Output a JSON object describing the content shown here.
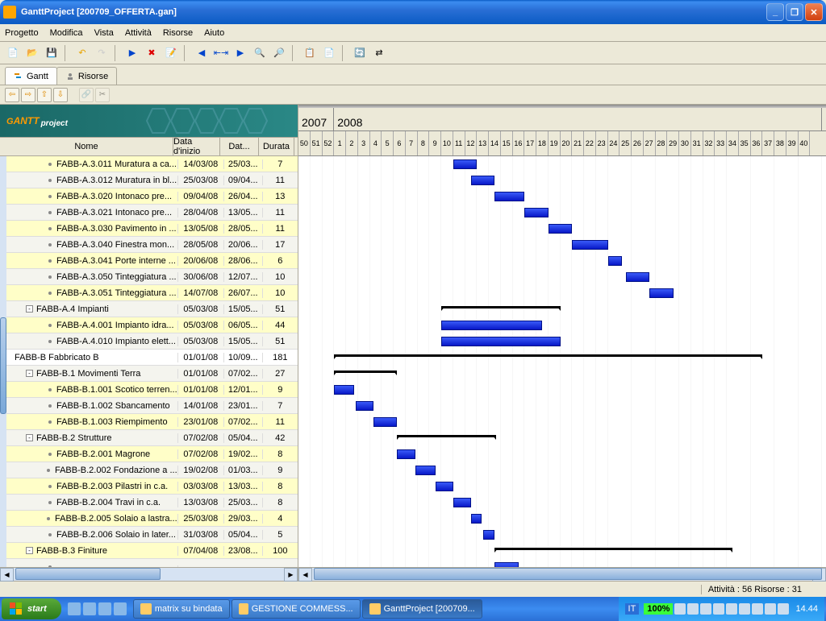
{
  "window": {
    "title": "GanttProject [200709_OFFERTA.gan]"
  },
  "menu": [
    "Progetto",
    "Modifica",
    "Vista",
    "Attività",
    "Risorse",
    "Aiuto"
  ],
  "tabs": {
    "gantt": "Gantt",
    "risorse": "Risorse"
  },
  "columns": {
    "name": "Nome",
    "start": "Data d'inizio",
    "end": "Dat...",
    "dur": "Durata"
  },
  "timeline": {
    "years": [
      {
        "label": "2007",
        "weeks": 3
      },
      {
        "label": "2008",
        "weeks": 41
      }
    ],
    "weeks": [
      50,
      51,
      52,
      1,
      2,
      3,
      4,
      5,
      6,
      7,
      8,
      9,
      10,
      11,
      12,
      13,
      14,
      15,
      16,
      17,
      18,
      19,
      20,
      21,
      22,
      23,
      24,
      25,
      26,
      27,
      28,
      29,
      30,
      31,
      32,
      33,
      34,
      35,
      36,
      37,
      38,
      39,
      40
    ]
  },
  "tasks": [
    {
      "name": "FABB-A.3.011 Muratura a ca...",
      "start": "14/03/08",
      "end": "25/03...",
      "dur": "7",
      "indent": 3,
      "type": "task",
      "barStart": 13,
      "barLen": 2,
      "alt": false,
      "sel": true
    },
    {
      "name": "FABB-A.3.012 Muratura in bl...",
      "start": "25/03/08",
      "end": "09/04...",
      "dur": "11",
      "indent": 3,
      "type": "task",
      "barStart": 14.5,
      "barLen": 2,
      "alt": true
    },
    {
      "name": "FABB-A.3.020 Intonaco pre...",
      "start": "09/04/08",
      "end": "26/04...",
      "dur": "13",
      "indent": 3,
      "type": "task",
      "barStart": 16.5,
      "barLen": 2.5,
      "alt": false,
      "sel": true
    },
    {
      "name": "FABB-A.3.021 Intonaco pre...",
      "start": "28/04/08",
      "end": "13/05...",
      "dur": "11",
      "indent": 3,
      "type": "task",
      "barStart": 19,
      "barLen": 2,
      "alt": true
    },
    {
      "name": "FABB-A.3.030 Pavimento in ...",
      "start": "13/05/08",
      "end": "28/05...",
      "dur": "11",
      "indent": 3,
      "type": "task",
      "barStart": 21,
      "barLen": 2,
      "alt": false,
      "sel": true
    },
    {
      "name": "FABB-A.3.040 Finestra mon...",
      "start": "28/05/08",
      "end": "20/06...",
      "dur": "17",
      "indent": 3,
      "type": "task",
      "barStart": 23,
      "barLen": 3,
      "alt": true
    },
    {
      "name": "FABB-A.3.041 Porte interne ...",
      "start": "20/06/08",
      "end": "28/06...",
      "dur": "6",
      "indent": 3,
      "type": "task",
      "barStart": 26,
      "barLen": 1.2,
      "alt": false,
      "sel": true
    },
    {
      "name": "FABB-A.3.050 Tinteggiatura ...",
      "start": "30/06/08",
      "end": "12/07...",
      "dur": "10",
      "indent": 3,
      "type": "task",
      "barStart": 27.5,
      "barLen": 2,
      "alt": true
    },
    {
      "name": "FABB-A.3.051 Tinteggiatura ...",
      "start": "14/07/08",
      "end": "26/07...",
      "dur": "10",
      "indent": 3,
      "type": "task",
      "barStart": 29.5,
      "barLen": 2,
      "alt": false,
      "sel": true
    },
    {
      "name": "FABB-A.4 Impianti",
      "start": "05/03/08",
      "end": "15/05...",
      "dur": "51",
      "indent": 1,
      "type": "summary",
      "barStart": 12,
      "barLen": 10,
      "alt": true,
      "exp": "-"
    },
    {
      "name": "FABB-A.4.001 Impianto idra...",
      "start": "05/03/08",
      "end": "06/05...",
      "dur": "44",
      "indent": 3,
      "type": "task",
      "barStart": 12,
      "barLen": 8.5,
      "alt": false,
      "sel": true
    },
    {
      "name": "FABB-A.4.010 Impianto elett...",
      "start": "05/03/08",
      "end": "15/05...",
      "dur": "51",
      "indent": 3,
      "type": "task",
      "barStart": 12,
      "barLen": 10,
      "alt": true
    },
    {
      "name": "FABB-B Fabbricato B",
      "start": "01/01/08",
      "end": "10/09...",
      "dur": "181",
      "indent": 0,
      "type": "summary",
      "barStart": 3,
      "barLen": 36,
      "alt": false
    },
    {
      "name": "FABB-B.1 Movimenti Terra",
      "start": "01/01/08",
      "end": "07/02...",
      "dur": "27",
      "indent": 1,
      "type": "summary",
      "barStart": 3,
      "barLen": 5.3,
      "alt": true,
      "exp": "-"
    },
    {
      "name": "FABB-B.1.001 Scotico terren...",
      "start": "01/01/08",
      "end": "12/01...",
      "dur": "9",
      "indent": 3,
      "type": "task",
      "barStart": 3,
      "barLen": 1.7,
      "alt": false,
      "sel": true
    },
    {
      "name": "FABB-B.1.002 Sbancamento",
      "start": "14/01/08",
      "end": "23/01...",
      "dur": "7",
      "indent": 3,
      "type": "task",
      "barStart": 4.8,
      "barLen": 1.5,
      "alt": true
    },
    {
      "name": "FABB-B.1.003 Riempimento",
      "start": "23/01/08",
      "end": "07/02...",
      "dur": "11",
      "indent": 3,
      "type": "task",
      "barStart": 6.3,
      "barLen": 2,
      "alt": false,
      "sel": true
    },
    {
      "name": "FABB-B.2 Strutture",
      "start": "07/02/08",
      "end": "05/04...",
      "dur": "42",
      "indent": 1,
      "type": "summary",
      "barStart": 8.3,
      "barLen": 8.3,
      "alt": true,
      "exp": "-"
    },
    {
      "name": "FABB-B.2.001 Magrone",
      "start": "07/02/08",
      "end": "19/02...",
      "dur": "8",
      "indent": 3,
      "type": "task",
      "barStart": 8.3,
      "barLen": 1.5,
      "alt": false,
      "sel": true
    },
    {
      "name": "FABB-B.2.002 Fondazione a ...",
      "start": "19/02/08",
      "end": "01/03...",
      "dur": "9",
      "indent": 3,
      "type": "task",
      "barStart": 9.8,
      "barLen": 1.7,
      "alt": true
    },
    {
      "name": "FABB-B.2.003 Pilastri in c.a.",
      "start": "03/03/08",
      "end": "13/03...",
      "dur": "8",
      "indent": 3,
      "type": "task",
      "barStart": 11.5,
      "barLen": 1.5,
      "alt": false,
      "sel": true
    },
    {
      "name": "FABB-B.2.004 Travi in c.a.",
      "start": "13/03/08",
      "end": "25/03...",
      "dur": "8",
      "indent": 3,
      "type": "task",
      "barStart": 13,
      "barLen": 1.5,
      "alt": true
    },
    {
      "name": "FABB-B.2.005 Solaio a lastra...",
      "start": "25/03/08",
      "end": "29/03...",
      "dur": "4",
      "indent": 3,
      "type": "task",
      "barStart": 14.5,
      "barLen": 0.9,
      "alt": false,
      "sel": true
    },
    {
      "name": "FABB-B.2.006 Solaio in later...",
      "start": "31/03/08",
      "end": "05/04...",
      "dur": "5",
      "indent": 3,
      "type": "task",
      "barStart": 15.5,
      "barLen": 1,
      "alt": true
    },
    {
      "name": "FABB-B.3 Finiture",
      "start": "07/04/08",
      "end": "23/08...",
      "dur": "100",
      "indent": 1,
      "type": "summary",
      "barStart": 16.5,
      "barLen": 20,
      "alt": false,
      "sel": true,
      "exp": "-"
    },
    {
      "name": "",
      "start": "",
      "end": "",
      "dur": "",
      "indent": 3,
      "type": "task",
      "barStart": 16.5,
      "barLen": 2,
      "alt": true,
      "partial": true
    }
  ],
  "status": "Attività : 56  Risorse : 31",
  "taskbar": {
    "start": "start",
    "items": [
      {
        "label": "matrix su bindata",
        "active": false
      },
      {
        "label": "GESTIONE COMMESS...",
        "active": false
      },
      {
        "label": "GanttProject [200709...",
        "active": true
      }
    ],
    "lang": "IT",
    "battery": "100%",
    "clock": "14.44"
  },
  "logo": "GANTT project"
}
